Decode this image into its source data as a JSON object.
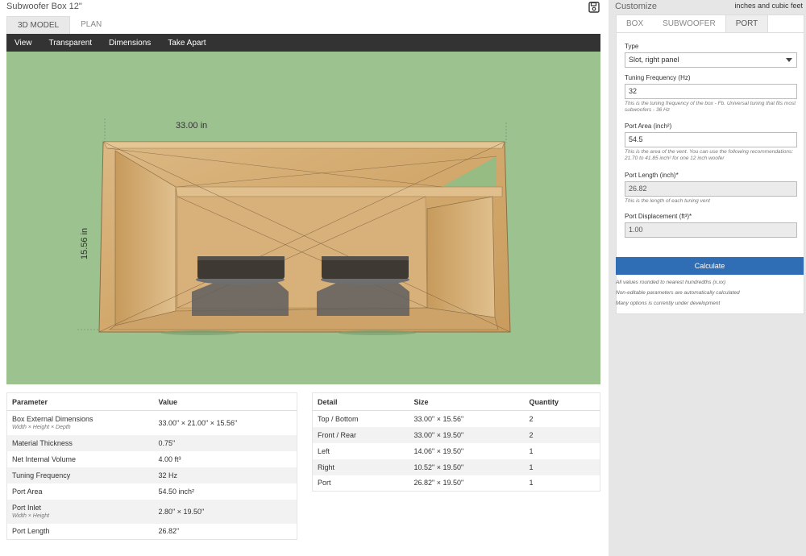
{
  "window_title": "Subwoofer Box 12\"",
  "tabs": [
    {
      "label": "3D MODEL"
    },
    {
      "label": "PLAN"
    }
  ],
  "toolbar": [
    "View",
    "Transparent",
    "Dimensions",
    "Take Apart"
  ],
  "model": {
    "width_label": "33.00 in",
    "height_label": "15.56 in"
  },
  "params_table": {
    "headers": [
      "Parameter",
      "Value"
    ],
    "rows": [
      {
        "param": "Box External Dimensions",
        "sub": "Width × Height × Depth",
        "value": "33.00\" × 21.00\" × 15.56\""
      },
      {
        "param": "Material Thickness",
        "sub": "",
        "value": "0.75\""
      },
      {
        "param": "Net Internal Volume",
        "sub": "",
        "value": "4.00 ft³"
      },
      {
        "param": "Tuning Frequency",
        "sub": "",
        "value": "32 Hz"
      },
      {
        "param": "Port Area",
        "sub": "",
        "value": "54.50 inch²"
      },
      {
        "param": "Port Inlet",
        "sub": "Width × Height",
        "value": "2.80\" × 19.50\""
      },
      {
        "param": "Port Length",
        "sub": "",
        "value": "26.82\""
      }
    ]
  },
  "detail_table": {
    "headers": [
      "Detail",
      "Size",
      "Quantity"
    ],
    "rows": [
      {
        "detail": "Top / Bottom",
        "size": "33.00\" × 15.56\"",
        "qty": "2"
      },
      {
        "detail": "Front / Rear",
        "size": "33.00\" × 19.50\"",
        "qty": "2"
      },
      {
        "detail": "Left",
        "size": "14.06\" × 19.50\"",
        "qty": "1"
      },
      {
        "detail": "Right",
        "size": "10.52\" × 19.50\"",
        "qty": "1"
      },
      {
        "detail": "Port",
        "size": "26.82\" × 19.50\"",
        "qty": "1"
      }
    ]
  },
  "customize": {
    "title": "Customize",
    "units": "inches and cubic feet",
    "tabs": [
      {
        "label": "BOX"
      },
      {
        "label": "SUBWOOFER"
      },
      {
        "label": "PORT"
      }
    ],
    "type_label": "Type",
    "type_value": "Slot, right panel",
    "tuning_label": "Tuning Frequency (Hz)",
    "tuning_value": "32",
    "tuning_help": "This is the tuning frequency of the box - Fb. Universal tuning that fits most subwoofers - 36 Hz",
    "area_label": "Port Area (inch²)",
    "area_value": "54.5",
    "area_help": "This is the area of the vent. You can use the following recommendations: 21.70 to 41.85 inch² for one 12 inch woofer",
    "length_label": "Port Length (inch)*",
    "length_value": "26.82",
    "length_help": "This is the length of each tuning vent",
    "disp_label": "Port Displacement (ft³)*",
    "disp_value": "1.00",
    "calculate_label": "Calculate",
    "notes": [
      "All values rounded to nearest hundredths (x.xx)",
      "Non-editable parameters are automatically calculated",
      "Many options is currently under development"
    ]
  },
  "colors": {
    "viewport": "#9cc28f",
    "toolbar": "#333333",
    "calculate": "#2f6db5"
  }
}
